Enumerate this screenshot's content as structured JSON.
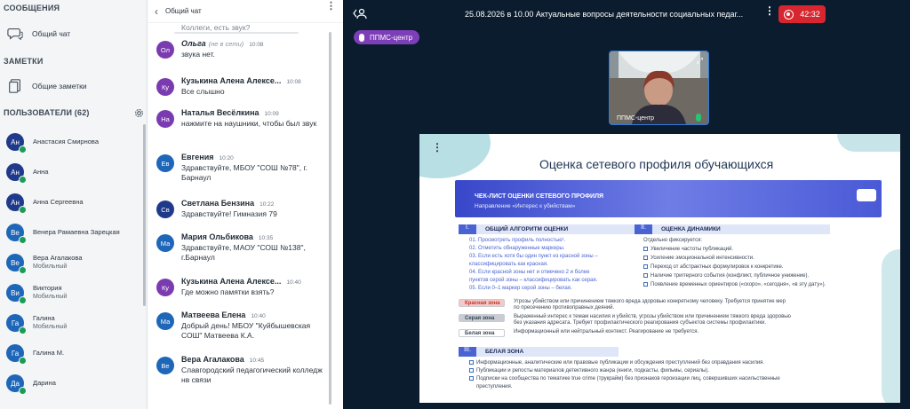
{
  "left": {
    "messages_title": "СООБЩЕНИЯ",
    "public_chat": "Общий чат",
    "notes_title": "ЗАМЕТКИ",
    "shared_notes": "Общие заметки",
    "users_title": "ПОЛЬЗОВАТЕЛИ (62)",
    "users": [
      {
        "initials": "Ан",
        "name": "Анастасия Смирнова",
        "sub": "",
        "color": "#1f3a8a"
      },
      {
        "initials": "Ан",
        "name": "Анна",
        "sub": "",
        "color": "#1f3a8a"
      },
      {
        "initials": "Ан",
        "name": "Анна Сергеевна",
        "sub": "",
        "color": "#1f3a8a"
      },
      {
        "initials": "Ве",
        "name": "Венера Рамаевна Зарецкая",
        "sub": "",
        "color": "#1e66b8"
      },
      {
        "initials": "Ве",
        "name": "Вера Агалакова",
        "sub": "Мобильный",
        "color": "#1e66b8"
      },
      {
        "initials": "Ви",
        "name": "Виктория",
        "sub": "Мобильный",
        "color": "#1e66b8"
      },
      {
        "initials": "Га",
        "name": "Галина",
        "sub": "Мобильный",
        "color": "#1e66b8"
      },
      {
        "initials": "Га",
        "name": "Галина М.",
        "sub": "",
        "color": "#1e66b8"
      },
      {
        "initials": "Да",
        "name": "Дарина",
        "sub": "",
        "color": "#1e66b8"
      }
    ]
  },
  "chat": {
    "title": "Общий чат",
    "top_partial": "Коллеги, есть звук?",
    "messages": [
      {
        "initials": "Ол",
        "name": "Ольга",
        "offline": "(не в сети)",
        "time": "10:08",
        "text": "звука нет.",
        "color": "#7a3bb0"
      },
      {
        "initials": "Ку",
        "name": "Кузькина Алена Алексе...",
        "offline": "",
        "time": "10:08",
        "text": "Все слышно",
        "color": "#7a3bb0"
      },
      {
        "initials": "На",
        "name": "Наталья Весёлкина",
        "offline": "",
        "time": "10:09",
        "text": "нажмите на наушники, чтобы был звук",
        "color": "#7a3bb0"
      },
      {
        "initials": "Ев",
        "name": "Евгения",
        "offline": "",
        "time": "10:20",
        "text": "Здравствуйте, МБОУ \"СОШ №78\", г. Барнаул",
        "color": "#1e66b8"
      },
      {
        "initials": "Св",
        "name": "Светлана Бензина",
        "offline": "",
        "time": "10:22",
        "text": "Здравствуйте! Гимназия 79",
        "color": "#1f3a8a"
      },
      {
        "initials": "Ма",
        "name": "Мария Ольбикова",
        "offline": "",
        "time": "10:35",
        "text": "Здравствуйте, МАОУ \"СОШ №138\", г.Барнаул",
        "color": "#1e66b8"
      },
      {
        "initials": "Ку",
        "name": "Кузькина Алена Алексе...",
        "offline": "",
        "time": "10:40",
        "text": "Где можно памятки взять?",
        "color": "#7a3bb0"
      },
      {
        "initials": "Ма",
        "name": "Матвеева Елена",
        "offline": "",
        "time": "10:40",
        "text": "Добрый день! МБОУ \"Куйбышевская СОШ\" Матвеева К.А.",
        "color": "#1e66b8"
      },
      {
        "initials": "Ве",
        "name": "Вера Агалакова",
        "offline": "",
        "time": "10:45",
        "text": "Славгородский педагогический колледж нв связи",
        "color": "#1e66b8"
      }
    ]
  },
  "main": {
    "title": "25.08.2026 в 10.00 Актуальные вопросы деятельности социальных педаг...",
    "timer": "42:32",
    "presenter_badge": "ППМС-центр",
    "camera_label": "ППМС-центр",
    "slide": {
      "title": "Оценка сетевого профиля обучающихся",
      "banner_title": "ЧЕК-ЛИСТ ОЦЕНКИ СЕТЕВОГО ПРОФИЛЯ",
      "banner_sub": "Направление «Интерес к убийствам»",
      "s1_num": "I.",
      "s1_title": "ОБЩИЙ АЛГОРИТМ ОЦЕНКИ",
      "s1_lines": [
        "01. Просмотреть профиль полностью¹.",
        "02. Отметить обнаруженные маркеры.",
        "03. Если есть хотя бы один пункт из красной зоны –",
        "классифицировать как красная.",
        "04. Если красной зоны нет и отмечено 2 и более",
        "пунктов серой зоны – классифицировать как серая.",
        "05. Если 0–1 маркер серой зоны – белая."
      ],
      "s2_num": "II.",
      "s2_title": "ОЦЕНКА ДИНАМИКИ",
      "s2_intro": "Отдельно фиксируется:",
      "s2_lines": [
        "Увеличение частоты публикаций.",
        "Усиление эмоциональной интенсивности.",
        "Переход от абстрактных формулировок к конкретике.",
        "Наличие триггерного события (конфликт, публичное унижение).",
        "Появление временных ориентиров («скоро», «сегодня», «в эту дату»)."
      ],
      "zones": [
        {
          "label": "Красная зона",
          "text": "Угрозы убийством или причинением тяжкого вреда здоровью конкретному человеку. Требуется принятие мер",
          "text2": "по пресечению противоправных деяний.",
          "bg": "#f4c9c9",
          "color": "#c0392b"
        },
        {
          "label": "Серая зона",
          "text": "Выраженный интерес к темам насилия и убийств, угрозы убийством или причинением тяжкого вреда здоровью",
          "text2": "без указания адресата. Требует профилактического реагирования субъектов системы профилактики.",
          "bg": "#c9cdd3",
          "color": "#3a4656"
        },
        {
          "label": "Белая зона",
          "text": "Информационный или нейтральный контекст. Реагирование не требуется.",
          "text2": "",
          "bg": "#ffffff",
          "color": "#3a4656"
        }
      ],
      "s3_num": "III.",
      "s3_title": "БЕЛАЯ ЗОНА",
      "s3_lines": [
        "Информационные, аналитические или правовые публикации и обсуждения преступлений без оправдания насилия.",
        "Публикации и репосты материалов детективного жанра (книги, подкасты, фильмы, сериалы).",
        "Подписки на сообщества по тематике true crime (трукрайм) без признаков героизации лиц, совершивших насильственные",
        "преступления."
      ]
    }
  }
}
